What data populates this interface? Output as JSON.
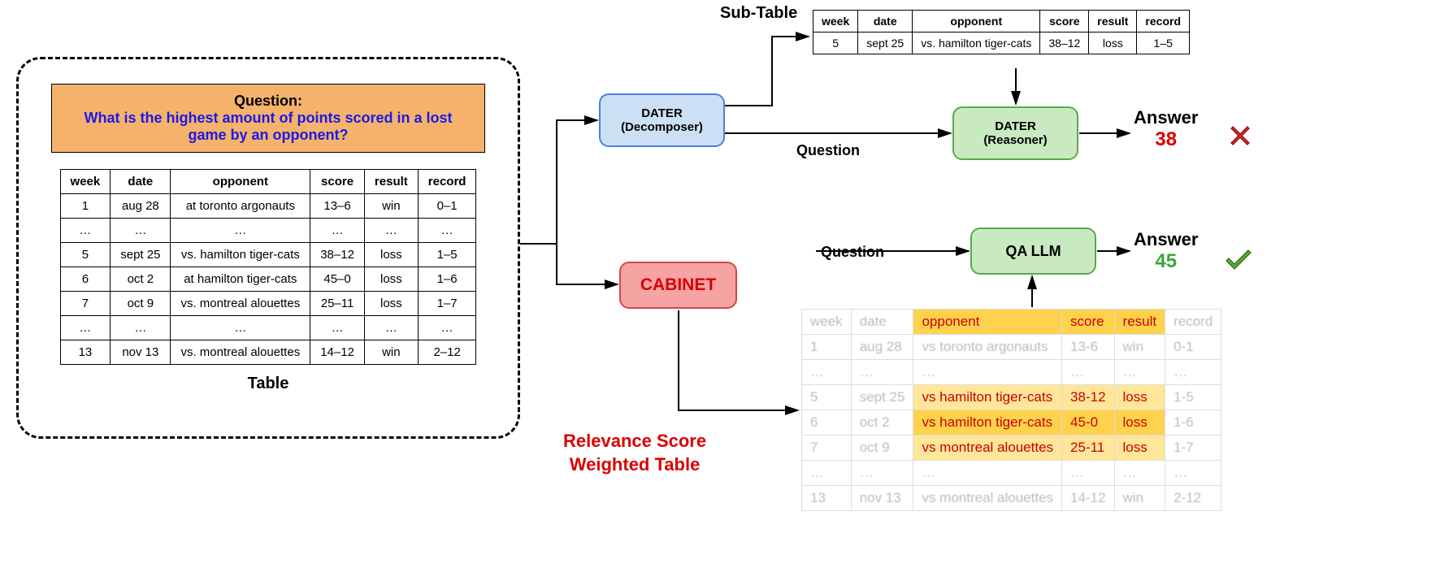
{
  "question": {
    "label": "Question:",
    "text": "What is the highest amount of points scored in a lost game by an opponent?"
  },
  "main_table": {
    "headers": [
      "week",
      "date",
      "opponent",
      "score",
      "result",
      "record"
    ],
    "rows": [
      [
        "1",
        "aug 28",
        "at toronto argonauts",
        "13–6",
        "win",
        "0–1"
      ],
      [
        "…",
        "…",
        "…",
        "…",
        "…",
        "…"
      ],
      [
        "5",
        "sept 25",
        "vs. hamilton tiger-cats",
        "38–12",
        "loss",
        "1–5"
      ],
      [
        "6",
        "oct 2",
        "at hamilton tiger-cats",
        "45–0",
        "loss",
        "1–6"
      ],
      [
        "7",
        "oct 9",
        "vs. montreal alouettes",
        "25–11",
        "loss",
        "1–7"
      ],
      [
        "…",
        "…",
        "…",
        "…",
        "…",
        "…"
      ],
      [
        "13",
        "nov 13",
        "vs. montreal alouettes",
        "14–12",
        "win",
        "2–12"
      ]
    ],
    "label": "Table"
  },
  "sub_table": {
    "label": "Sub-Table",
    "headers": [
      "week",
      "date",
      "opponent",
      "score",
      "result",
      "record"
    ],
    "rows": [
      [
        "5",
        "sept 25",
        "vs. hamilton tiger-cats",
        "38–12",
        "loss",
        "1–5"
      ]
    ]
  },
  "modules": {
    "dater_decomp_l1": "DATER",
    "dater_decomp_l2": "(Decomposer)",
    "dater_reas_l1": "DATER",
    "dater_reas_l2": "(Reasoner)",
    "cabinet": "CABINET",
    "qallm": "QA LLM"
  },
  "labels": {
    "question": "Question",
    "answer": "Answer",
    "relevance_l1": "Relevance Score",
    "relevance_l2": "Weighted Table"
  },
  "answers": {
    "a1": "38",
    "a2": "45"
  },
  "weighted_table": {
    "rows": [
      {
        "cells": [
          "week",
          "date",
          "opponent",
          "score",
          "result",
          "record"
        ],
        "class": [
          "blur",
          "blur",
          "hl-dark",
          "hl-dark",
          "hl-dark",
          "blur"
        ]
      },
      {
        "cells": [
          "1",
          "aug 28",
          "vs toronto argonauts",
          "13-6",
          "win",
          "0-1"
        ],
        "class": [
          "blur",
          "blur",
          "blur",
          "blur",
          "blur",
          "blur"
        ]
      },
      {
        "cells": [
          "…",
          "…",
          "…",
          "…",
          "…",
          "…"
        ],
        "class": [
          "blur",
          "blur",
          "blur",
          "blur",
          "blur",
          "blur"
        ]
      },
      {
        "cells": [
          "5",
          "sept 25",
          "vs hamilton tiger-cats",
          "38-12",
          "loss",
          "1-5"
        ],
        "class": [
          "blur",
          "blur",
          "hl-light",
          "hl-light",
          "hl-light",
          "blur"
        ]
      },
      {
        "cells": [
          "6",
          "oct 2",
          "vs hamilton tiger-cats",
          "45-0",
          "loss",
          "1-6"
        ],
        "class": [
          "blur",
          "blur",
          "hl-dark",
          "hl-dark",
          "hl-dark",
          "blur"
        ]
      },
      {
        "cells": [
          "7",
          "oct 9",
          "vs montreal alouettes",
          "25-11",
          "loss",
          "1-7"
        ],
        "class": [
          "blur",
          "blur",
          "hl-light",
          "hl-light",
          "hl-light",
          "blur"
        ]
      },
      {
        "cells": [
          "…",
          "…",
          "…",
          "…",
          "…",
          "…"
        ],
        "class": [
          "blur",
          "blur",
          "blur",
          "blur",
          "blur",
          "blur"
        ]
      },
      {
        "cells": [
          "13",
          "nov 13",
          "vs montreal alouettes",
          "14-12",
          "win",
          "2-12"
        ],
        "class": [
          "blur",
          "blur",
          "blur",
          "blur",
          "blur",
          "blur"
        ]
      }
    ]
  }
}
